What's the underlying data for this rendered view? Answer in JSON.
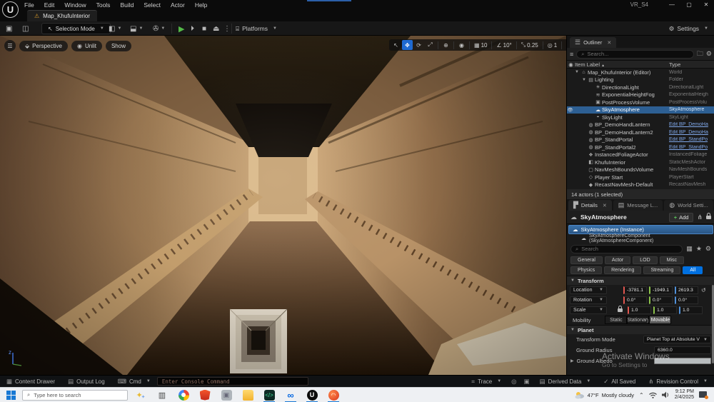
{
  "window": {
    "project": "VR_S4",
    "menus": [
      {
        "label": "File"
      },
      {
        "label": "Edit"
      },
      {
        "label": "Window"
      },
      {
        "label": "Tools"
      },
      {
        "label": "Build"
      },
      {
        "label": "Select"
      },
      {
        "label": "Actor"
      },
      {
        "label": "Help"
      }
    ],
    "tab": "Map_KhufuInterior",
    "minimize": "—",
    "maximize": "▢",
    "close": "✕"
  },
  "toolbar": {
    "selection_mode": "Selection Mode",
    "platforms": "Platforms",
    "settings": "Settings"
  },
  "viewport": {
    "perspective": "Perspective",
    "view_mode": "Unlit",
    "show": "Show",
    "grid_snap": "10",
    "angle_snap": "10°",
    "scale_snap": "0.25",
    "camera_speed": "1",
    "gizmo_axis": "z"
  },
  "outliner": {
    "tab": "Outliner",
    "search_placeholder": "Search...",
    "columns": {
      "label": "Item Label",
      "sort": "▲",
      "type": "Type"
    },
    "rows": [
      {
        "glyph": "⌂",
        "label": "Map_KhufuInterior (Editor)",
        "type": "World",
        "indent": 0,
        "caret": true
      },
      {
        "glyph": "▤",
        "label": "Lighting",
        "type": "Folder",
        "indent": 1,
        "caret": true
      },
      {
        "glyph": "☀",
        "label": "DirectionalLight",
        "type": "DirectionalLight",
        "indent": 2
      },
      {
        "glyph": "≋",
        "label": "ExponentialHeightFog",
        "type": "ExponentialHeigh",
        "indent": 2
      },
      {
        "glyph": "▣",
        "label": "PostProcessVolume",
        "type": "PostProcessVolu",
        "indent": 2
      },
      {
        "glyph": "☁",
        "label": "SkyAtmosphere",
        "type": "SkyAtmosphere",
        "indent": 2,
        "selected": true
      },
      {
        "glyph": "◓",
        "label": "SkyLight",
        "type": "SkyLight",
        "indent": 2
      },
      {
        "glyph": "◍",
        "label": "BP_DemoHandLantern",
        "type": "Edit BP_DemoHa",
        "indent": 1,
        "link": true
      },
      {
        "glyph": "◍",
        "label": "BP_DemoHandLantern2",
        "type": "Edit BP_DemoHa",
        "indent": 1,
        "link": true
      },
      {
        "glyph": "◍",
        "label": "BP_StandPortal",
        "type": "Edit BP_StandPo",
        "indent": 1,
        "link": true
      },
      {
        "glyph": "◍",
        "label": "BP_StandPortal2",
        "type": "Edit BP_StandPo",
        "indent": 1,
        "link": true
      },
      {
        "glyph": "❖",
        "label": "InstancedFoliageActor",
        "type": "InstancedFoliage",
        "indent": 1
      },
      {
        "glyph": "◧",
        "label": "KhufuInterior",
        "type": "StaticMeshActor",
        "indent": 1
      },
      {
        "glyph": "▢",
        "label": "NavMeshBoundsVolume",
        "type": "NavMeshBounds",
        "indent": 1
      },
      {
        "glyph": "◇",
        "label": "Player Start",
        "type": "PlayerStart",
        "indent": 1
      },
      {
        "glyph": "◆",
        "label": "RecastNavMesh-Default",
        "type": "RecastNavMesh",
        "indent": 1
      }
    ],
    "footer": "14 actors (1 selected)"
  },
  "details": {
    "tabs": {
      "details": "Details",
      "message_log": "Message L...",
      "world_settings": "World Setti..."
    },
    "actor_name": "SkyAtmosphere",
    "add_button": "Add",
    "instance_row": "SkyAtmosphere (Instance)",
    "component_row": "SkyAtmosphereComponent (SkyAtmosphereComponent)",
    "search_placeholder": "Search",
    "filter_chips": [
      {
        "label": "General"
      },
      {
        "label": "Actor"
      },
      {
        "label": "LOD"
      },
      {
        "label": "Misc"
      },
      {
        "label": "Physics"
      },
      {
        "label": "Rendering"
      },
      {
        "label": "Streaming"
      },
      {
        "label": "All",
        "active": true
      }
    ],
    "transform": {
      "section": "Transform",
      "location_label": "Location",
      "location": [
        "-3781.1",
        "-1949.1",
        "2619.3"
      ],
      "rotation_label": "Rotation",
      "rotation": [
        "0.0°",
        "0.0°",
        "0.0°"
      ],
      "scale_label": "Scale",
      "scale": [
        "1.0",
        "1.0",
        "1.0"
      ],
      "mobility_label": "Mobility",
      "mobility_options": [
        {
          "label": "Static"
        },
        {
          "label": "Stationary"
        },
        {
          "label": "Movable",
          "active": true
        }
      ]
    },
    "planet": {
      "section": "Planet",
      "transform_mode_label": "Transform Mode",
      "transform_mode_value": "Planet Top at Absolute V",
      "ground_radius_label": "Ground Radius",
      "ground_radius_value": "6360.0",
      "ground_albedo_label": "Ground Albedo"
    }
  },
  "statusbar": {
    "content_drawer": "Content Drawer",
    "output_log": "Output Log",
    "cmd": "Cmd",
    "console_placeholder": "Enter Console Command",
    "trace": "Trace",
    "derived_data": "Derived Data",
    "all_saved": "All Saved",
    "revision_control": "Revision Control"
  },
  "taskbar": {
    "search_placeholder": "Type here to search",
    "weather_temp": "47°F",
    "weather_desc": "Mostly cloudy",
    "time": "9:12 PM",
    "date": "2/4/2025"
  },
  "watermark": {
    "line1": "Activate Windows",
    "line2": "Go to Settings to"
  },
  "colors": {
    "accent_blue": "#0070e0",
    "selection_blue": "#2d5f93",
    "play_green": "#54b948",
    "warning_orange": "#d79a2b"
  }
}
